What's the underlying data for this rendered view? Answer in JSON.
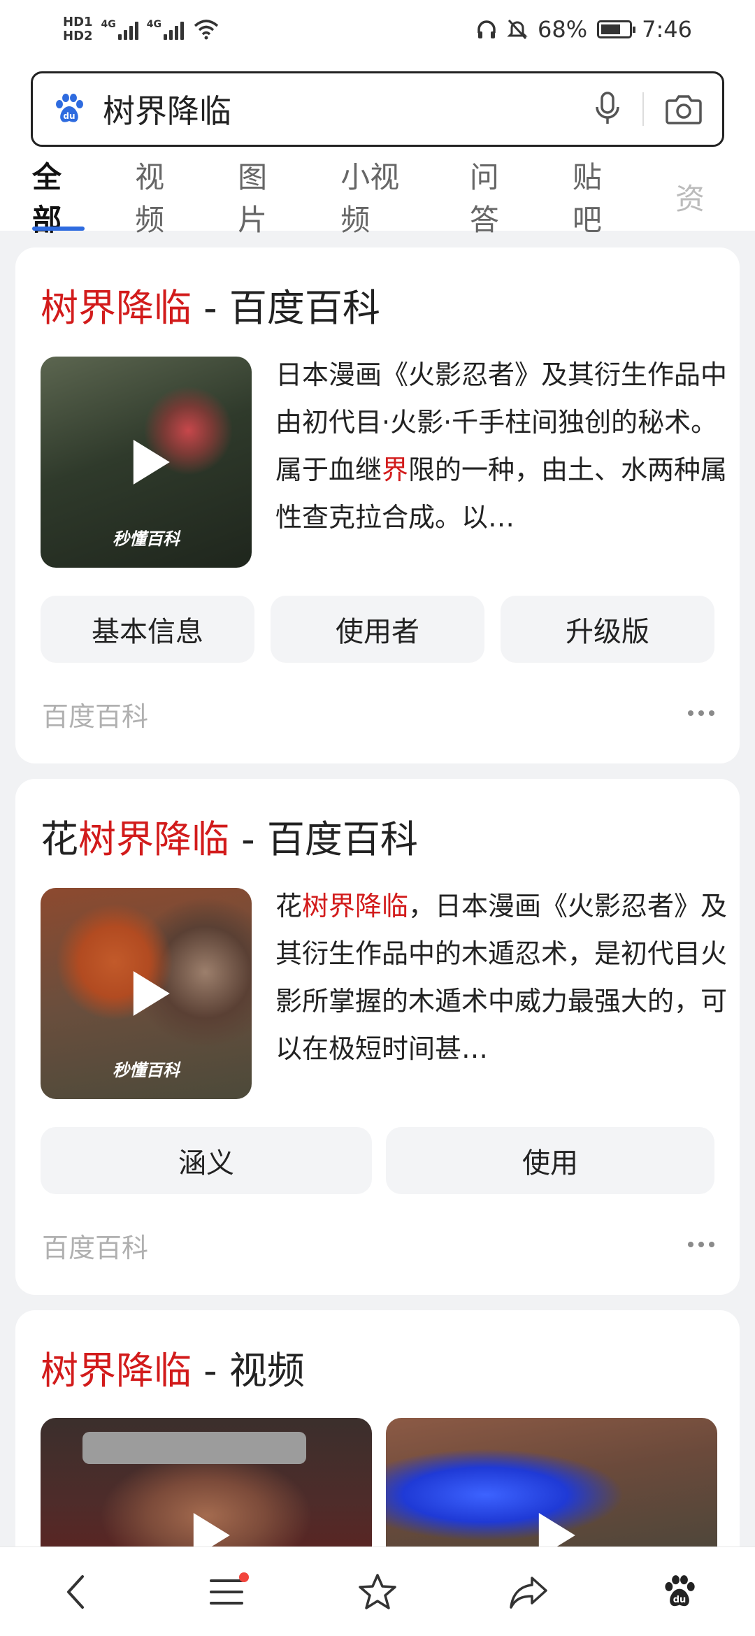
{
  "status_bar": {
    "hd1": "HD1",
    "hd2": "HD2",
    "net1": "4G",
    "net2": "4G",
    "battery_percent": "68%",
    "time": "7:46"
  },
  "search": {
    "query": "树界降临",
    "icons": [
      "baidu-paw-icon",
      "microphone-icon",
      "camera-icon"
    ]
  },
  "tabs": [
    {
      "label": "全部",
      "active": true
    },
    {
      "label": "视频",
      "active": false
    },
    {
      "label": "图片",
      "active": false
    },
    {
      "label": "小视频",
      "active": false
    },
    {
      "label": "问答",
      "active": false
    },
    {
      "label": "贴吧",
      "active": false
    },
    {
      "label": "资",
      "active": false
    }
  ],
  "cards": [
    {
      "title_highlight": "树界降临",
      "title_rest": " - 百度百科",
      "thumbnail_watermark": "秒懂百科",
      "description": {
        "part1": "日本漫画《火影忍者》及其衍生作品中由初代目·火影·千手柱间独创的秘术。属于血继",
        "highlight": "界",
        "part2": "限的一种，由土、水两种属性查克拉合成。以…"
      },
      "chips": [
        "基本信息",
        "使用者",
        "升级版"
      ],
      "source": "百度百科"
    },
    {
      "title_prefix": "花",
      "title_highlight": "树界降临",
      "title_rest": " - 百度百科",
      "thumbnail_watermark": "秒懂百科",
      "description": {
        "part1": "花",
        "highlight": "树界降临",
        "part2": "，日本漫画《火影忍者》及其衍生作品中的木遁忍术，是初代目火影所掌握的木遁术中威力最强大的，可以在极短时间甚…"
      },
      "chips": [
        "涵义",
        "使用"
      ],
      "source": "百度百科"
    },
    {
      "title_highlight": "树界降临",
      "title_rest": " - 视频"
    }
  ],
  "bottom_nav": {
    "icons": [
      "back-icon",
      "menu-icon",
      "star-icon",
      "share-icon",
      "baidu-paw-icon"
    ]
  },
  "colors": {
    "highlight": "#d21b1b",
    "tab_indicator": "#2e6bdf",
    "baidu_blue": "#2e6bdf",
    "notification_dot": "#f2453d"
  }
}
